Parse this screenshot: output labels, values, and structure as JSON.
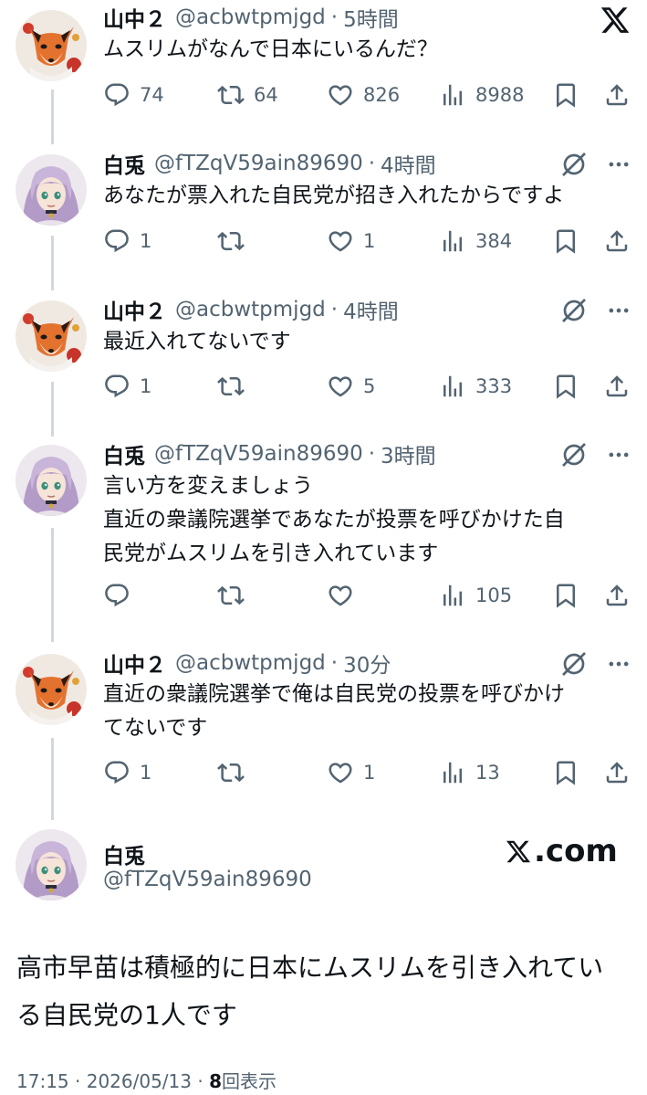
{
  "brand": {
    "x_logo": "x-logo-icon",
    "watermark": ".com"
  },
  "posts": [
    {
      "name": "山中２",
      "handle": "@acbwtpmjgd",
      "time": "5時間",
      "text": [
        "ムスリムがなんで日本にいるんだ？"
      ],
      "replies": "74",
      "reposts": "64",
      "likes": "826",
      "views": "8988"
    },
    {
      "name": "白兎",
      "handle": "@fTZqV59ain89690",
      "time": "4時間",
      "text": [
        "あなたが票入れた自民党が招き入れたからですよ"
      ],
      "replies": "1",
      "reposts": "",
      "likes": "1",
      "views": "384"
    },
    {
      "name": "山中２",
      "handle": "@acbwtpmjgd",
      "time": "4時間",
      "text": [
        "最近入れてないです"
      ],
      "replies": "1",
      "reposts": "",
      "likes": "5",
      "views": "333"
    },
    {
      "name": "白兎",
      "handle": "@fTZqV59ain89690",
      "time": "3時間",
      "text": [
        "言い方を変えましょう",
        "直近の衆議院選挙であなたが投票を呼びかけた自",
        "民党がムスリムを引き入れています"
      ],
      "replies": "",
      "reposts": "",
      "likes": "",
      "views": "105"
    },
    {
      "name": "山中２",
      "handle": "@acbwtpmjgd",
      "time": "30分",
      "text": [
        "直近の衆議院選挙で俺は自民党の投票を呼びかけ",
        "てないです"
      ],
      "replies": "1",
      "reposts": "",
      "likes": "1",
      "views": "13"
    }
  ],
  "main_post": {
    "name": "白兎",
    "handle": "@fTZqV59ain89690",
    "text": [
      "高市早苗は積極的に日本にムスリムを引き入れてい",
      "る自民党の1人です"
    ],
    "time": "17:15",
    "date": "2026/05/13",
    "views_count": "8",
    "views_label": "回表示",
    "separator": "·"
  },
  "meta": {
    "separator": "·"
  }
}
